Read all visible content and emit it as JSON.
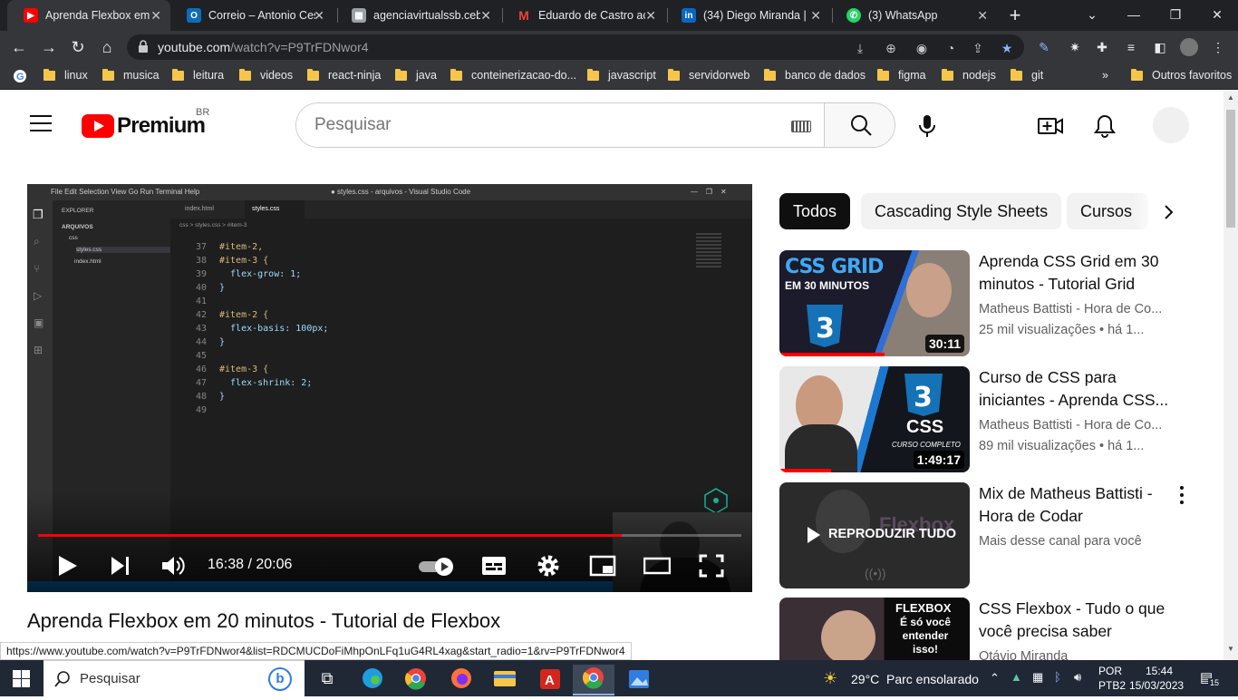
{
  "browser": {
    "tabs": [
      {
        "title": "Aprenda Flexbox em 2",
        "favicon": "youtube-icon",
        "color": "#ff0000",
        "active": true
      },
      {
        "title": "Correio – Antonio Ces",
        "favicon": "outlook-icon",
        "color": "#0f6cbd",
        "active": false
      },
      {
        "title": "agenciavirtualssb.cebi",
        "favicon": "site-icon",
        "color": "#9aa0a6",
        "active": false
      },
      {
        "title": "Eduardo de Castro aca",
        "favicon": "gmail-icon",
        "color": "#ea4335",
        "active": false
      },
      {
        "title": "(34) Diego Miranda | L",
        "favicon": "linkedin-icon",
        "color": "#0a66c2",
        "active": false
      },
      {
        "title": "(3) WhatsApp",
        "favicon": "whatsapp-icon",
        "color": "#25d366",
        "active": false
      }
    ],
    "url_host": "youtube.com",
    "url_path": "/watch?v=P9TrFDNwor4",
    "bookmarks": [
      "linux",
      "musica",
      "leitura",
      "videos",
      "react-ninja",
      "java",
      "conteinerizacao-do...",
      "javascript",
      "servidorweb",
      "banco de dados",
      "figma",
      "nodejs",
      "git"
    ],
    "bookmarks_more": "»",
    "other_bookmarks": "Outros favoritos"
  },
  "youtube": {
    "logo_text": "Premium",
    "country_code": "BR",
    "search_placeholder": "Pesquisar",
    "player": {
      "time_current": "16:38",
      "time_total": "20:06",
      "time_display": "16:38 / 20:06",
      "progress": 0.83,
      "vscode_title": "● styles.css - arquivos - Visual Studio Code",
      "vscode_menu": "File  Edit  Selection  View  Go  Run  Terminal  Help",
      "explorer_label": "EXPLORER",
      "folder_label": "ARQUIVOS",
      "files": [
        "css",
        "styles.css",
        "index.html"
      ],
      "editor_tabs": [
        "index.html",
        "styles.css"
      ],
      "breadcrumb": "css > styles.css > #item-3",
      "code_lines": [
        {
          "n": "37",
          "t": "#item-2,"
        },
        {
          "n": "38",
          "t": "#item-3 {"
        },
        {
          "n": "39",
          "t": "  flex-grow: 1;"
        },
        {
          "n": "40",
          "t": "}"
        },
        {
          "n": "41",
          "t": ""
        },
        {
          "n": "42",
          "t": "#item-2 {"
        },
        {
          "n": "43",
          "t": "  flex-basis: 100px;"
        },
        {
          "n": "44",
          "t": "}"
        },
        {
          "n": "45",
          "t": ""
        },
        {
          "n": "46",
          "t": "#item-3 {"
        },
        {
          "n": "47",
          "t": "  flex-shrink: 2;"
        },
        {
          "n": "48",
          "t": "}"
        },
        {
          "n": "49",
          "t": ""
        }
      ]
    },
    "video_title": "Aprenda Flexbox em 20 minutos - Tutorial de Flexbox",
    "status_url": "https://www.youtube.com/watch?v=P9TrFDNwor4&list=RDCMUCDoFiMhpOnLFq1uG4RL4xag&start_radio=1&rv=P9TrFDNwor4",
    "chips": [
      "Todos",
      "Cascading Style Sheets",
      "Cursos"
    ],
    "recommendations": [
      {
        "title": "Aprenda CSS Grid em 30 minutos - Tutorial Grid",
        "channel": "Matheus Battisti - Hora de Co...",
        "meta": "25 mil visualizações  • há 1...",
        "duration": "30:11",
        "thumb_text_1": "CSS GRID",
        "thumb_text_2": "EM 30 MINUTOS",
        "watched": 0.55
      },
      {
        "title": "Curso de CSS para iniciantes - Aprenda CSS...",
        "channel": "Matheus Battisti - Hora de Co...",
        "meta": "89 mil visualizações  • há 1...",
        "duration": "1:49:17",
        "thumb_text_1": "CSS",
        "thumb_text_2": "CURSO COMPLETO",
        "watched": 0.27
      },
      {
        "title": "Mix de Matheus Battisti - Hora de Codar",
        "channel": "Mais desse canal para você",
        "meta": "",
        "duration": "",
        "thumb_text_1": "REPRODUZIR TUDO",
        "thumb_text_2": "Flexbox",
        "watched": 0
      },
      {
        "title": "CSS Flexbox - Tudo o que você precisa saber",
        "channel": "Otávio Miranda",
        "meta": "",
        "duration": "",
        "thumb_text_1": "FLEXBOX",
        "thumb_text_2": "É só você entender isso!",
        "watched": 0
      }
    ]
  },
  "taskbar": {
    "search_label": "Pesquisar",
    "weather_temp": "29°C",
    "weather_text": "Parc ensolarado",
    "lang_1": "POR",
    "lang_2": "PTB2",
    "time": "15:44",
    "date": "15/03/2023",
    "notifications": "15"
  }
}
